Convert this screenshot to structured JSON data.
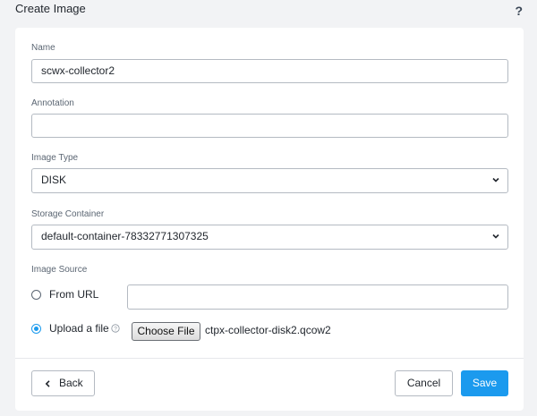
{
  "dialog": {
    "title": "Create Image",
    "help_icon": "question-mark-icon"
  },
  "fields": {
    "name": {
      "label": "Name",
      "value": "scwx-collector2"
    },
    "annotation": {
      "label": "Annotation",
      "value": ""
    },
    "image_type": {
      "label": "Image Type",
      "value": "DISK"
    },
    "storage_container": {
      "label": "Storage Container",
      "value": "default-container-78332771307325"
    }
  },
  "image_source": {
    "label": "Image Source",
    "options": [
      {
        "label": "From URL",
        "selected": false,
        "url_value": ""
      },
      {
        "label": "Upload a file",
        "selected": true
      }
    ],
    "choose_file_label": "Choose File",
    "file_name": "ctpx-collector-disk2.qcow2"
  },
  "footer": {
    "back_label": "Back",
    "cancel_label": "Cancel",
    "save_label": "Save"
  },
  "colors": {
    "accent": "#1b9aee",
    "panel_bg": "#ffffff",
    "page_bg": "#f2f3f5"
  }
}
